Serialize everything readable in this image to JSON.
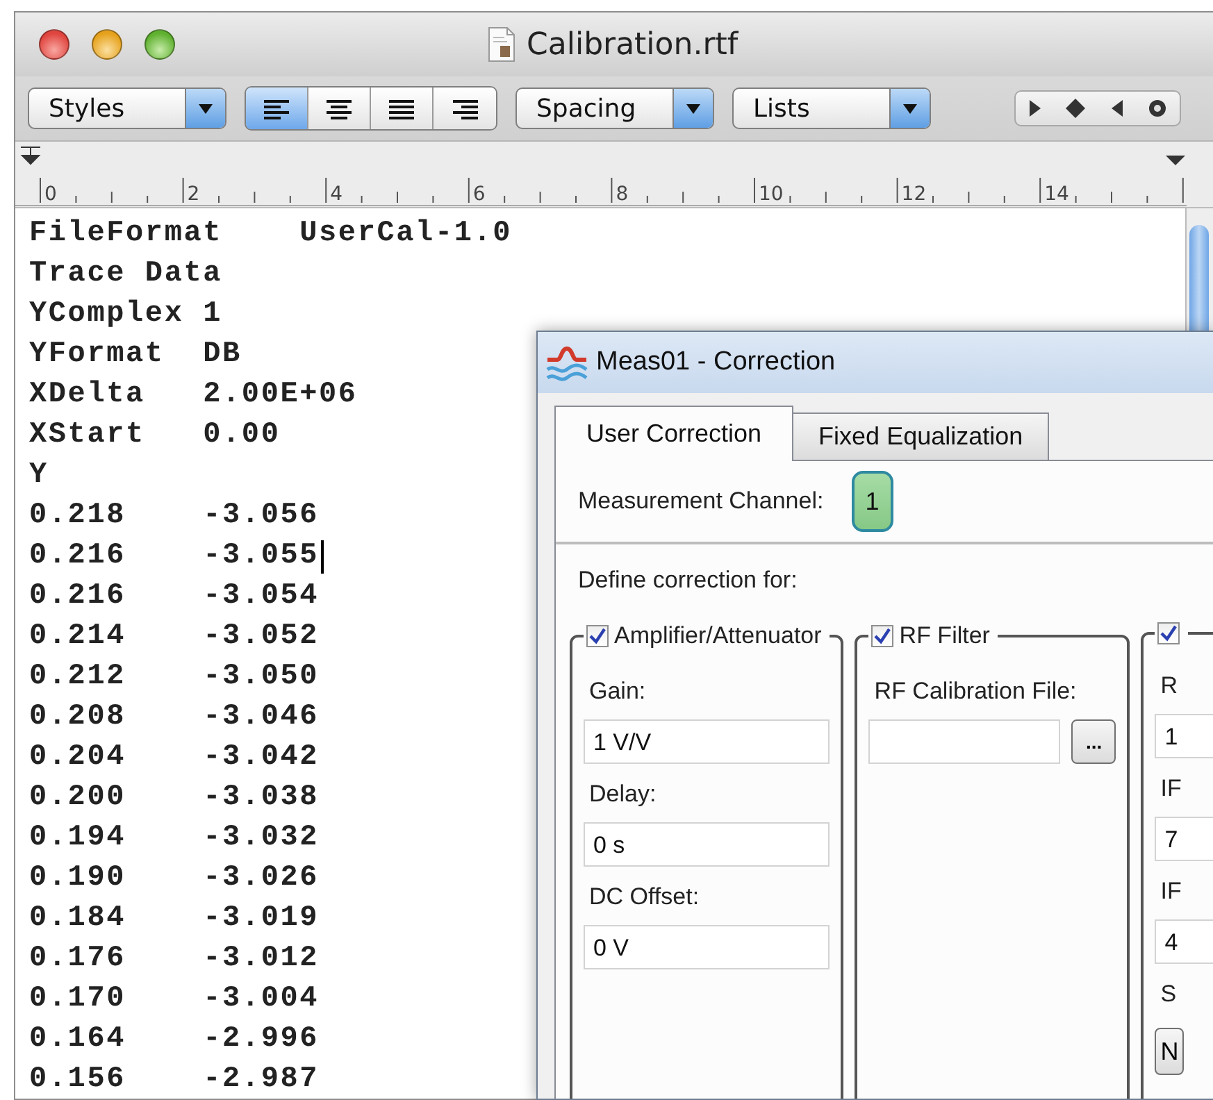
{
  "window": {
    "title": "Calibration.rtf"
  },
  "toolbar": {
    "styles_popup": "Styles",
    "alignment": [
      {
        "kind": "left",
        "selected": true
      },
      {
        "kind": "center",
        "selected": false
      },
      {
        "kind": "justify",
        "selected": false
      },
      {
        "kind": "right",
        "selected": false
      }
    ],
    "spacing_popup": "Spacing",
    "lists_popup": "Lists"
  },
  "ruler": {
    "labels": [
      "0",
      "2",
      "4",
      "6",
      "8",
      "10",
      "12",
      "14"
    ]
  },
  "document": {
    "lines": [
      {
        "text": "FileFormat    UserCal-1.0",
        "caret": false
      },
      {
        "text": "Trace Data",
        "caret": false
      },
      {
        "text": "YComplex 1",
        "caret": false
      },
      {
        "text": "YFormat  DB",
        "caret": false
      },
      {
        "text": "XDelta   2.00E+06",
        "caret": false
      },
      {
        "text": "XStart   0.00",
        "caret": false
      },
      {
        "text": "Y",
        "caret": false
      },
      {
        "text": "0.218    -3.056",
        "caret": false
      },
      {
        "text": "0.216    -3.055",
        "caret": true
      },
      {
        "text": "0.216    -3.054",
        "caret": false
      },
      {
        "text": "0.214    -3.052",
        "caret": false
      },
      {
        "text": "0.212    -3.050",
        "caret": false
      },
      {
        "text": "0.208    -3.046",
        "caret": false
      },
      {
        "text": "0.204    -3.042",
        "caret": false
      },
      {
        "text": "0.200    -3.038",
        "caret": false
      },
      {
        "text": "0.194    -3.032",
        "caret": false
      },
      {
        "text": "0.190    -3.026",
        "caret": false
      },
      {
        "text": "0.184    -3.019",
        "caret": false
      },
      {
        "text": "0.176    -3.012",
        "caret": false
      },
      {
        "text": "0.170    -3.004",
        "caret": false
      },
      {
        "text": "0.164    -2.996",
        "caret": false
      },
      {
        "text": "0.156    -2.987",
        "caret": false
      }
    ]
  },
  "dialog": {
    "title": "Meas01 - Correction",
    "tabs": [
      {
        "label": "User Correction",
        "selected": true
      },
      {
        "label": "Fixed Equalization",
        "selected": false
      }
    ],
    "channel_label": "Measurement Channel:",
    "channel_button": "1",
    "define_label": "Define correction for:",
    "groups": [
      {
        "label": "Amplifier/Attenuator",
        "checked": true,
        "items": [
          {
            "kind": "label",
            "text": "Gain:"
          },
          {
            "kind": "field",
            "value": "1 V/V"
          },
          {
            "kind": "label",
            "text": "Delay:"
          },
          {
            "kind": "field",
            "value": "0 s"
          },
          {
            "kind": "label",
            "text": "DC Offset:"
          },
          {
            "kind": "field",
            "value": "0 V"
          }
        ]
      },
      {
        "label": "RF Filter",
        "checked": true,
        "items": [
          {
            "kind": "label",
            "text": "RF Calibration File:"
          },
          {
            "kind": "file",
            "button": "..."
          }
        ]
      },
      {
        "checked": true,
        "items": [
          {
            "kind": "label",
            "text": "R"
          },
          {
            "kind": "field",
            "value": "1"
          },
          {
            "kind": "label",
            "text": "IF"
          },
          {
            "kind": "field",
            "value": "7"
          },
          {
            "kind": "label",
            "text": "IF"
          },
          {
            "kind": "field",
            "value": "4"
          },
          {
            "kind": "label",
            "text": "S"
          },
          {
            "kind": "button",
            "text": "N"
          }
        ]
      }
    ]
  }
}
